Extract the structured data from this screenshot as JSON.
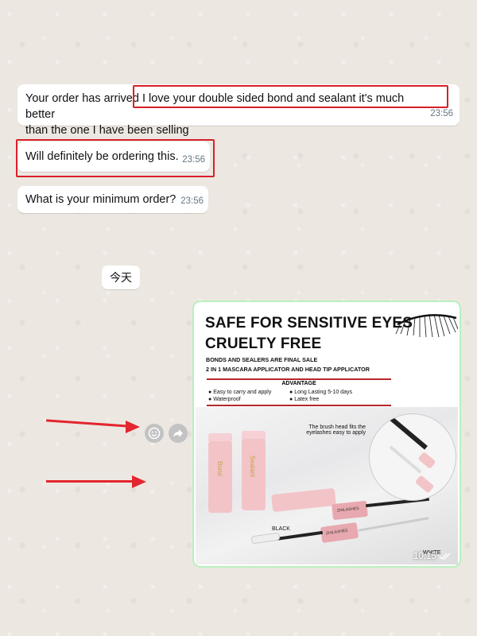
{
  "messages": [
    {
      "text_before": "Your order has arrived",
      "text_highlight": "I love your double sided bond and sealant it's much better",
      "text_after": "than the one I have been selling",
      "time": "23:56"
    },
    {
      "text": "Will definitely be ordering this.",
      "time": "23:56"
    },
    {
      "text": "What is your minimum order?",
      "time": "23:56"
    }
  ],
  "date_separator": "今天",
  "image_message": {
    "time": "10:15",
    "status_icon": "double-check-icon",
    "product": {
      "headline_1": "SAFE FOR SENSITIVE EYES",
      "headline_2": "CRUELTY FREE",
      "sub_1": "BONDS AND SEALERS ARE FINAL SALE",
      "sub_2": "2 IN 1 MASCARA APPLICATOR AND HEAD TIP APPLICATOR",
      "advantage_title": "ADVANTAGE",
      "advantages": [
        "Easy to carry and apply",
        "Long Lasting 5-10 days",
        "Waterproof",
        "Latex free"
      ],
      "callout": "The brush head fits the eyelashes easy to apply",
      "label_black": "BLACK",
      "label_white": "WHITE",
      "brand": "ZHILASHES",
      "tube_texts": [
        "Bond",
        "Sealant"
      ]
    }
  },
  "actions": {
    "emoji_icon": "smiley-icon",
    "forward_icon": "forward-icon"
  },
  "colors": {
    "highlight": "#d8202a",
    "arrow": "#e3262f",
    "accent_rule": "#b5272d"
  }
}
